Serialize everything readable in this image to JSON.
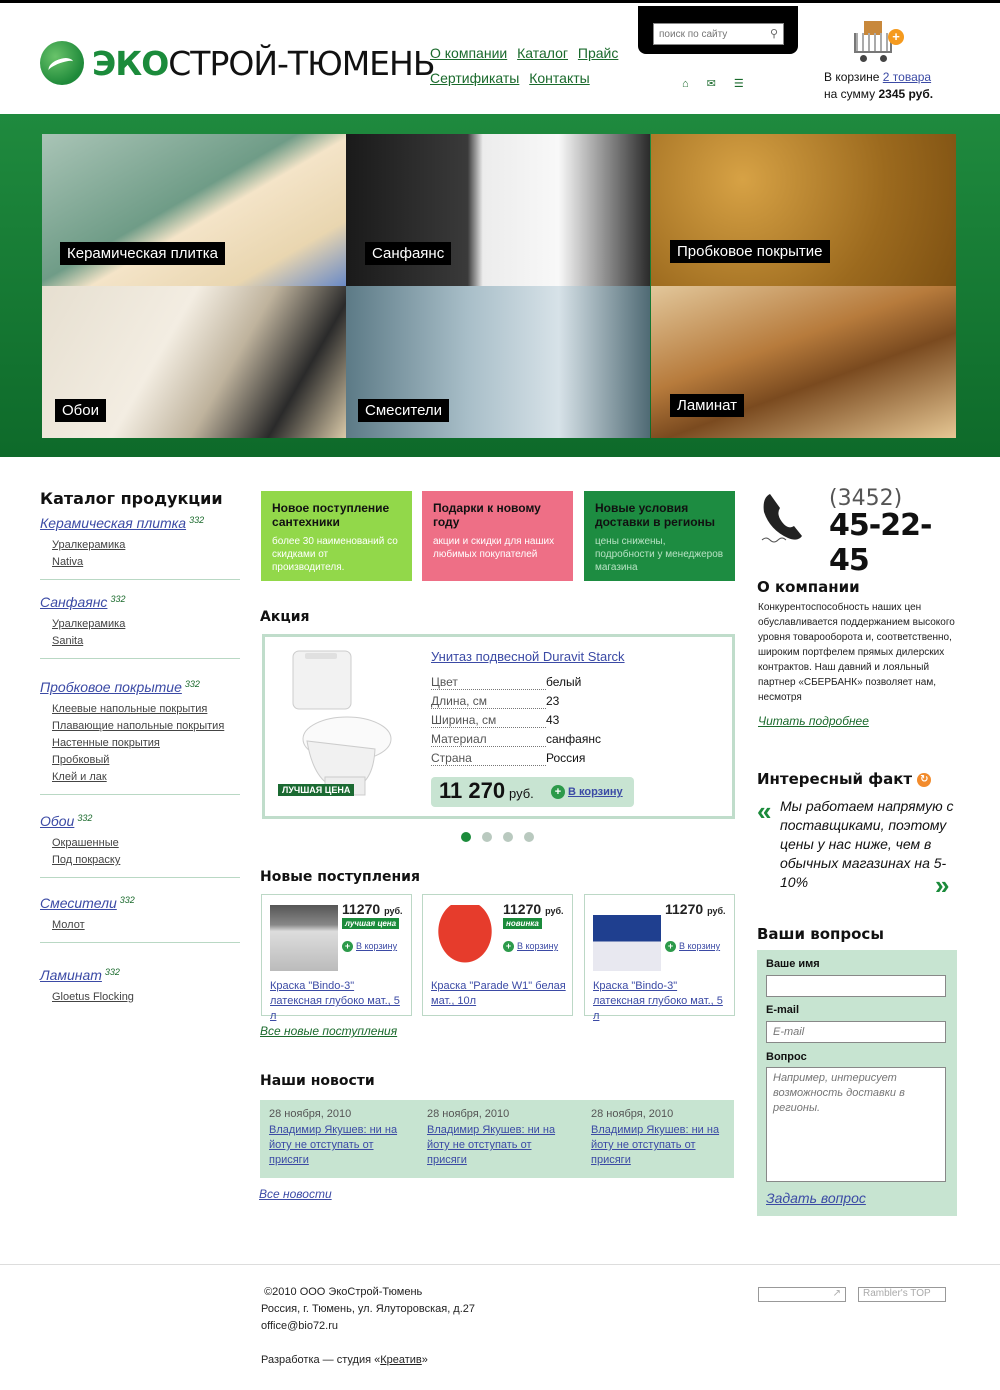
{
  "header": {
    "logo_eko": "ЭКО",
    "logo_rest": "СТРОЙ-ТЮМЕНЬ",
    "nav": [
      "О компании",
      "Каталог",
      "Прайс",
      "Сертификаты",
      "Контакты"
    ],
    "search_placeholder": "поиск по сайту",
    "cart_line1_prefix": "В корзине ",
    "cart_line1_link": "2 товара",
    "cart_line2_prefix": "на сумму ",
    "cart_line2_value": "2345 руб."
  },
  "hero_tiles": [
    "Керамическая плитка",
    "Санфаянс",
    "Пробковое покрытие",
    "Обои",
    "Смесители",
    "Ламинат"
  ],
  "catalog": {
    "title": "Каталог продукции",
    "groups": [
      {
        "name": "Керамическая плитка",
        "count": "332",
        "items": [
          "Уралкерамика",
          "Nativa"
        ]
      },
      {
        "name": "Санфаянс",
        "count": "332",
        "items": [
          "Уралкерамика",
          "Sanita"
        ]
      },
      {
        "name": "Пробковое покрытие",
        "count": "332",
        "items": [
          "Клеевые напольные покрытия",
          "Плавающие напольные покрытия",
          "Настенные покрытия",
          "Пробковый",
          "Клей и лак"
        ]
      },
      {
        "name": "Обои",
        "count": "332",
        "items": [
          "Окрашенные",
          "Под покраску"
        ]
      },
      {
        "name": "Смесители",
        "count": "332",
        "items": [
          "Молот"
        ]
      },
      {
        "name": "Ламинат",
        "count": "332",
        "items": [
          "Gloetus Flocking"
        ]
      }
    ]
  },
  "promos": [
    {
      "title": "Новое поступление сантехники",
      "text": "более 30 наименований со скидками от производителя.",
      "color": "#92d84a"
    },
    {
      "title": "Подарки к новому году",
      "text": "акции и скидки для наших любимых покупателей",
      "color": "#ee6f86"
    },
    {
      "title": "Новые условия доставки в регионы",
      "text": "цены снижены, подробности у менеджеров магазина",
      "color": "#1d8c41"
    }
  ],
  "akcia": {
    "title": "Акция",
    "product_name": "Унитаз подвесной Duravit Starck",
    "badge": "ЛУЧШАЯ ЦЕНА",
    "specs": [
      {
        "k": "Цвет",
        "v": "белый"
      },
      {
        "k": "Длина, см",
        "v": "23"
      },
      {
        "k": "Ширина, см",
        "v": "43"
      },
      {
        "k": "Материал",
        "v": "санфаянс"
      },
      {
        "k": "Страна",
        "v": "Россия"
      }
    ],
    "price": "11 270",
    "currency": "руб.",
    "cart_label": "В корзину",
    "slides": 4,
    "active_slide": 1
  },
  "new_arrivals": {
    "title": "Новые поступления",
    "all_link": "Все новые поступления",
    "items": [
      {
        "price": "11270",
        "currency": "руб.",
        "badge": "лучшая цена",
        "cart": "В корзину",
        "name": "Краска \"Bindo-3\" латексная глубоко мат., 5 л"
      },
      {
        "price": "11270",
        "currency": "руб.",
        "badge": "новинка",
        "cart": "В корзину",
        "name": "Краска \"Parade W1\" белая мат., 10л"
      },
      {
        "price": "11270",
        "currency": "руб.",
        "badge": "",
        "cart": "В корзину",
        "name": "Краска \"Bindo-3\" латексная глубоко мат., 5 л"
      }
    ]
  },
  "news": {
    "title": "Наши новости",
    "all_link": "Все новости",
    "items": [
      {
        "date": "28 ноября, 2010",
        "text": "Владимир Якушев: ни на йоту не отступать от присяги"
      },
      {
        "date": "28 ноября, 2010",
        "text": "Владимир Якушев: ни на йоту не отступать от присяги"
      },
      {
        "date": "28 ноября, 2010",
        "text": "Владимир Якушев: ни на йоту не отступать от присяги"
      }
    ]
  },
  "phone": {
    "code": "(3452)",
    "number": "45-22-45"
  },
  "about": {
    "title": "О компании",
    "text": "Конкурентоспособность наших цен обуславливается поддержанием высокого уровня товарооборота и, соответственно, широким портфелем прямых дилерских контрактов. Наш давний и лояльный партнер «СБЕРБАНК» позволяет нам, несмотря",
    "more": "Читать подробнее"
  },
  "fact": {
    "title": "Интересный факт",
    "text": "Мы работаем напрямую с поставщиками, поэтому цены у нас ниже, чем в обычных магазинах на 5-10%"
  },
  "questions": {
    "title": "Ваши вопросы",
    "name_label": "Ваше имя",
    "email_label": "E-mail",
    "email_placeholder": "E-mail",
    "question_label": "Вопрос",
    "question_placeholder": "Например, интерисует возможность доставки в регионы.",
    "submit": "Задать вопрос"
  },
  "footer": {
    "copyright": "©2010 ООО ЭкоСтрой-Тюмень",
    "address": "Россия, г. Тюмень, ул. Ялуторовская, д.27",
    "email": "office@bio72.ru",
    "dev_prefix": "Разработка — студия «",
    "dev_link": "Креатив",
    "dev_suffix": "»",
    "rambler": "Rambler's TOP"
  }
}
